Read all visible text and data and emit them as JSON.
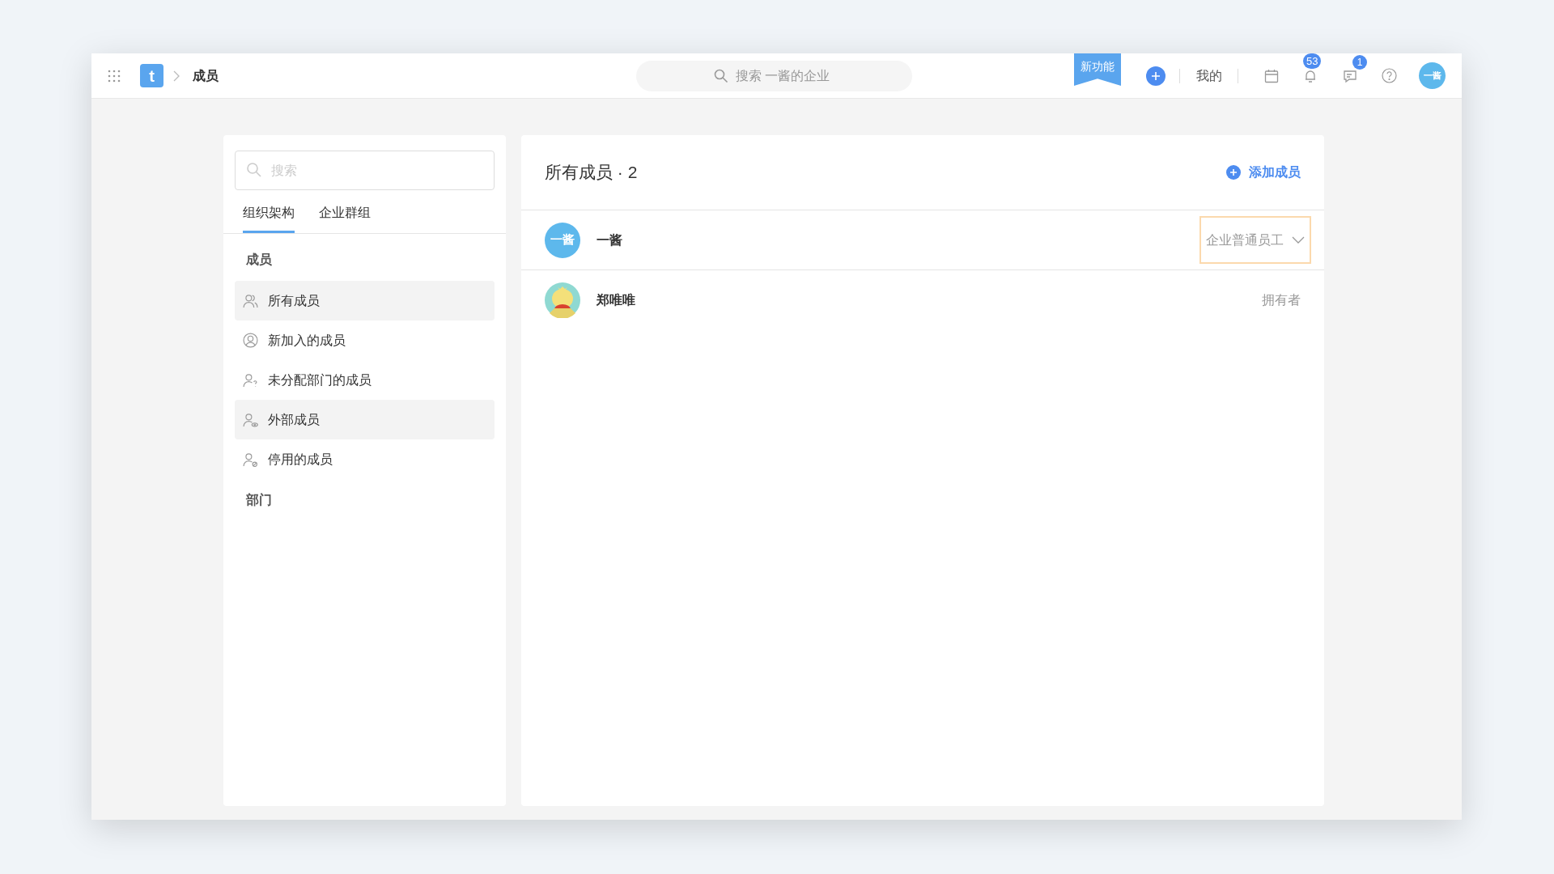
{
  "top_bar": {
    "logo": "t",
    "breadcrumb": "成员",
    "search": {
      "placeholder": "搜索 一酱的企业"
    },
    "new_feature": "新功能",
    "my": "我的",
    "notifications_badge": "53",
    "messages_badge": "1",
    "avatar": "一酱"
  },
  "sidebar": {
    "search": {
      "placeholder": "搜索"
    },
    "tabs": [
      {
        "label": "组织架构",
        "selected": true
      },
      {
        "label": "企业群组",
        "selected": false
      }
    ],
    "sections": [
      {
        "title": "成员",
        "items": [
          {
            "label": "所有成员",
            "selected": true
          },
          {
            "label": "新加入的成员",
            "selected": false
          },
          {
            "label": "未分配部门的成员",
            "selected": false
          },
          {
            "label": "外部成员",
            "selected": true
          },
          {
            "label": "停用的成员",
            "selected": false
          }
        ]
      },
      {
        "title": "部门"
      }
    ]
  },
  "members": {
    "title": "所有成员 · 2",
    "add_button": "添加成员",
    "rows": [
      {
        "avatar": {
          "kind": "initials",
          "text": "一酱"
        },
        "name": "一酱",
        "role": {
          "kind": "dropdown",
          "text": "企业普通员工"
        }
      },
      {
        "name": "郑唯唯",
        "role": {
          "kind": "text",
          "text": "拥有者"
        }
      }
    ]
  }
}
